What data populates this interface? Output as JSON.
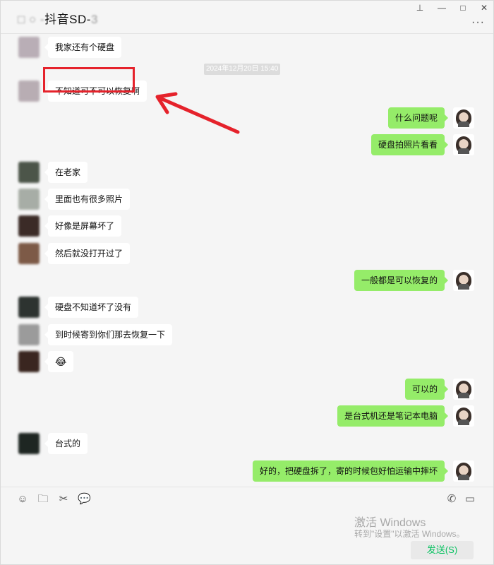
{
  "window": {
    "title_blurred_prefix": "□ ○ -",
    "title_main": "抖音SD-",
    "title_blurred_suffix": "3",
    "pin_label": "⊥",
    "minimize_label": "—",
    "maximize_label": "□",
    "close_label": "✕",
    "more_label": "···"
  },
  "timestamp": "2024年12月20日 15:40",
  "messages": [
    {
      "side": "left",
      "text": "我家还有个硬盘",
      "avatar_color": "#b9aeb6"
    },
    {
      "side": "left",
      "text": "不知道可不可以恢复啊",
      "avatar_color": "#b8adb3"
    },
    {
      "side": "right",
      "text": "什么问题呢"
    },
    {
      "side": "right",
      "text": "硬盘拍照片看看"
    },
    {
      "side": "left",
      "text": "在老家",
      "avatar_color": "#4c5549"
    },
    {
      "side": "left",
      "text": "里面也有很多照片",
      "avatar_color": "#a7ada6"
    },
    {
      "side": "left",
      "text": "好像是屏幕坏了",
      "avatar_color": "#3b2b27"
    },
    {
      "side": "left",
      "text": "然后就没打开过了",
      "avatar_color": "#7d5a47"
    },
    {
      "side": "right",
      "text": "一般都是可以恢复的"
    },
    {
      "side": "left",
      "text": "硬盘不知道坏了没有",
      "avatar_color": "#2d3330"
    },
    {
      "side": "left",
      "text": "到时候寄到你们那去恢复一下",
      "avatar_color": "#9b9b9b"
    },
    {
      "side": "left",
      "text": "😂",
      "avatar_color": "#3a2620"
    },
    {
      "side": "right",
      "text": "可以的"
    },
    {
      "side": "right",
      "text": "是台式机还是笔记本电脑"
    },
    {
      "side": "left",
      "text": "台式的",
      "avatar_color": "#1e2622"
    },
    {
      "side": "right",
      "text": "好的，把硬盘拆了，寄的时候包好怕运输中摔坏"
    }
  ],
  "toolbar": {
    "emoji_icon": "☺",
    "folder_icon": "🗀",
    "scissors_icon": "✂",
    "chat_icon": "💬",
    "phone_icon": "✆",
    "video_icon": "▭"
  },
  "watermark": {
    "line1": "激活 Windows",
    "line2": "转到\"设置\"以激活 Windows。"
  },
  "send_label": "发送(S)",
  "annotation_color": "#e5222b"
}
